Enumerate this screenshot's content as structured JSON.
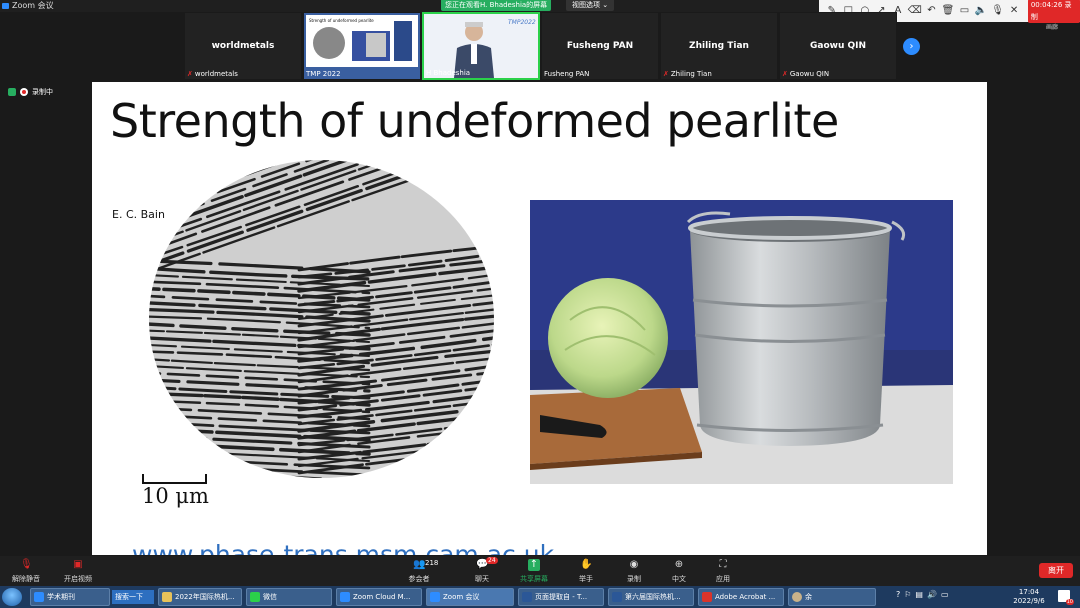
{
  "window": {
    "title": "Zoom 会议",
    "share_banner": "您正在观看H. Bhadeshia的屏幕",
    "view_options": "视图选项 ⌄"
  },
  "annotation_toolbar": {
    "timer": "00:04:26 录制",
    "gallery_label": "画廊"
  },
  "gallery": {
    "tiles": [
      {
        "name": "worldmetals",
        "footer": "worldmetals",
        "muted": true
      },
      {
        "name": "",
        "footer": "TMP 2022",
        "muted": false
      },
      {
        "name": "",
        "footer": "H Bhadeshia",
        "muted": false,
        "active": true
      },
      {
        "name": "Fusheng PAN",
        "footer": "Fusheng PAN",
        "muted": false
      },
      {
        "name": "Zhiling Tian",
        "footer": "Zhiling Tian",
        "muted": true
      },
      {
        "name": "Gaowu QIN",
        "footer": "Gaowu QIN",
        "muted": true
      }
    ]
  },
  "recording": {
    "label": "录制中"
  },
  "slide": {
    "title": "Strength of undeformed pearlite",
    "author": "E. C. Bain",
    "scale_label": "10 μm",
    "url": "www.phase-trans.msm.cam.ac.uk"
  },
  "controls": {
    "unmute": "解除静音",
    "video": "开启视频",
    "participants": "参会者",
    "participants_count": "218",
    "chat": "聊天",
    "chat_badge": "24",
    "share": "共享屏幕",
    "raise_hand": "举手",
    "record": "录制",
    "language": "中文",
    "apps": "应用",
    "leave": "离开"
  },
  "taskbar": {
    "search": "搜索一下",
    "items": [
      {
        "label": "学术期刊",
        "color": "#2d8cff"
      },
      {
        "label": "2022年国际热机...",
        "color": "#e8c25a"
      },
      {
        "label": "微信",
        "color": "#2bd14a"
      },
      {
        "label": "Zoom Cloud M...",
        "color": "#2d8cff"
      },
      {
        "label": "Zoom 会议",
        "color": "#2d8cff"
      },
      {
        "label": "页面提取自 - T...",
        "color": "#2b5797"
      },
      {
        "label": "第六届国际热机...",
        "color": "#2b5797"
      },
      {
        "label": "Adobe Acrobat ...",
        "color": "#d9342b"
      },
      {
        "label": "余",
        "color": "#c9b28a"
      }
    ],
    "time": "17:04",
    "date": "2022/9/6",
    "notifications": "10"
  }
}
